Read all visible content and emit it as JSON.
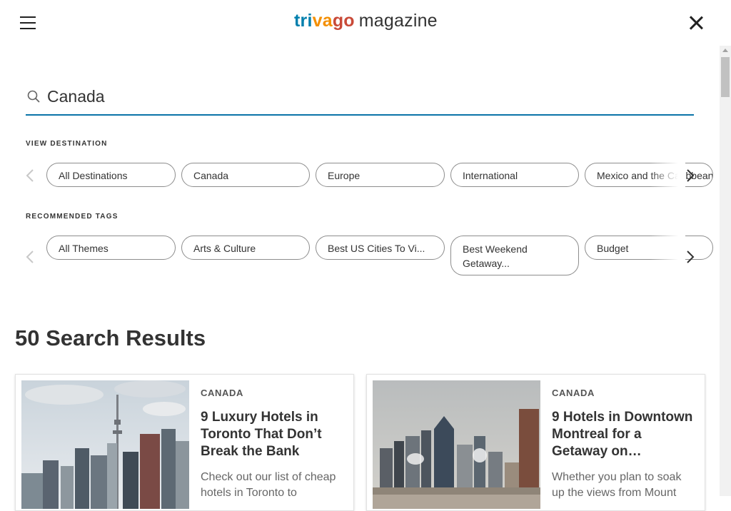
{
  "header": {
    "logo_tri": "tri",
    "logo_va": "va",
    "logo_go": "go",
    "logo_magazine": "magazine",
    "menu_icon": "hamburger-menu-icon",
    "close_icon": "close-icon"
  },
  "search": {
    "value": "Canada",
    "icon": "search-icon"
  },
  "destinations": {
    "label": "VIEW DESTINATION",
    "chips": [
      "All Destinations",
      "Canada",
      "Europe",
      "International",
      "Mexico and the Caribbean"
    ]
  },
  "tags": {
    "label": "RECOMMENDED TAGS",
    "chips": [
      "All Themes",
      "Arts & Culture",
      "Best US Cities To Vi...",
      "Best Weekend Getaway...",
      "Budget"
    ]
  },
  "results": {
    "title": "50 Search Results",
    "cards": [
      {
        "category": "CANADA",
        "title": "9 Luxury Hotels in Toronto That Don’t Break the Bank",
        "description": "Check out our list of cheap hotels in Toronto to"
      },
      {
        "category": "CANADA",
        "title": "9 Hotels in Downtown Montreal for a Getaway on…",
        "description": "Whether you plan to soak up the views from Mount"
      }
    ]
  },
  "colors": {
    "accent": "#0a74a8",
    "logo_blue": "#007fad",
    "logo_orange": "#f48f00",
    "logo_red": "#c94a38"
  }
}
